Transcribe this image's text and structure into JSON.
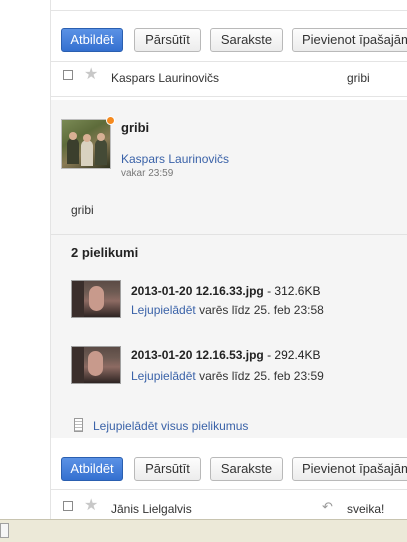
{
  "toolbar_top": {
    "reply": "Atbildēt",
    "forward": "Pārsūtīt",
    "chat": "Sarakste",
    "add_property": "Pievienot īpašajām"
  },
  "toolbar_bottom": {
    "reply": "Atbildēt",
    "forward": "Pārsūtīt",
    "chat": "Sarakste",
    "add_property": "Pievienot īpašajām"
  },
  "message_row_1": {
    "sender": "Kaspars Laurinovičs",
    "subject": "gribi"
  },
  "message": {
    "subject": "gribi",
    "from": "Kaspars Laurinovičs",
    "time": "vakar 23:59",
    "body": "gribi"
  },
  "attachments": {
    "header": "2 pielikumi",
    "items": [
      {
        "filename": "2013-01-20 12.16.33.jpg",
        "size": " - 312.6KB",
        "download": "Lejupielādēt",
        "expiry": " varēs līdz 25. feb 23:58"
      },
      {
        "filename": "2013-01-20 12.16.53.jpg",
        "size": " - 292.4KB",
        "download": "Lejupielādēt",
        "expiry": " varēs līdz 25. feb 23:59"
      }
    ],
    "download_all": "Lejupielādēt visus pielikumus"
  },
  "message_row_2": {
    "sender": "Jānis Lielgalvis",
    "subject": "sveika!"
  },
  "icons": {
    "star": "★",
    "reply": "↶"
  },
  "colors": {
    "primary_button": "#3470d0",
    "link": "#3a62a8",
    "online_indicator": "#f58a1f"
  }
}
